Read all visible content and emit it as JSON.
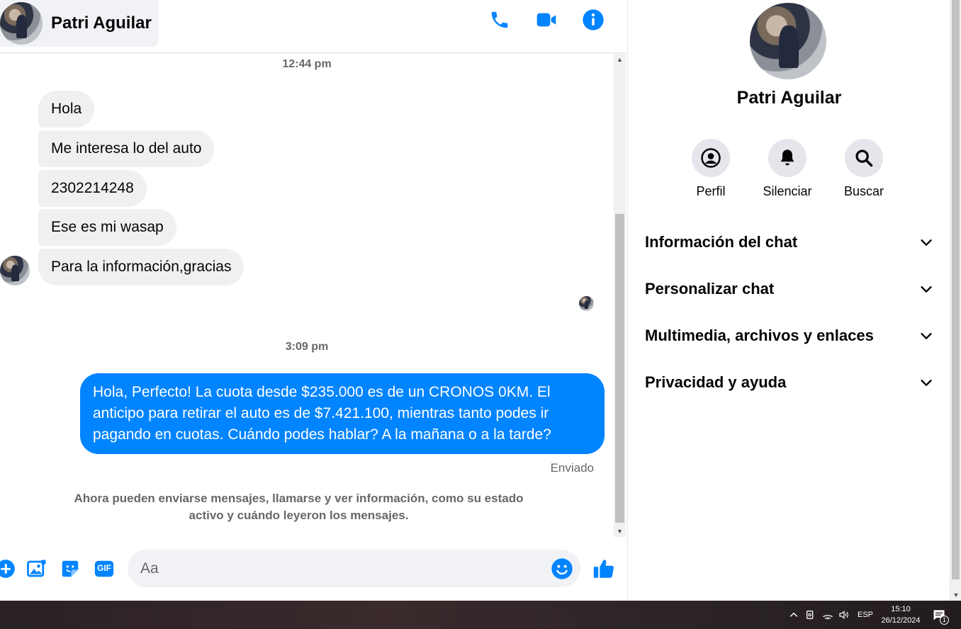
{
  "header": {
    "contact_name": "Patri Aguilar",
    "icons": [
      "phone-icon",
      "video-call-icon",
      "info-icon"
    ]
  },
  "conversation": {
    "divider_1": "12:44 pm",
    "incoming": [
      "Hola",
      "Me interesa lo del auto",
      "2302214248",
      "Ese es mi wasap",
      "Para la información,gracias"
    ],
    "divider_2": "3:09 pm",
    "outgoing": "Hola, Perfecto! La cuota desde $235.000 es de un CRONOS 0KM. El anticipo para retirar el auto es de $7.421.100, mientras tanto podes ir pagando en cuotas. Cuándo podes hablar? A la mañana o a la tarde?",
    "status": "Enviado",
    "notice": "Ahora pueden enviarse mensajes, llamarse y ver información, como su estado activo y cuándo leyeron los mensajes."
  },
  "composer": {
    "placeholder": "Aa",
    "icons": [
      "plus-icon",
      "image-icon",
      "sticker-icon",
      "gif-icon",
      "emoji-icon",
      "like-icon"
    ],
    "gif_label": "GIF"
  },
  "side_panel": {
    "name": "Patri Aguilar",
    "actions": [
      {
        "label": "Perfil",
        "icon": "profile-icon"
      },
      {
        "label": "Silenciar",
        "icon": "bell-icon"
      },
      {
        "label": "Buscar",
        "icon": "search-icon"
      }
    ],
    "sections": [
      "Información del chat",
      "Personalizar chat",
      "Multimedia, archivos y enlaces",
      "Privacidad y ayuda"
    ]
  },
  "taskbar": {
    "language": "ESP",
    "time": "15:10",
    "date": "26/12/2024",
    "notification_count": "1"
  },
  "colors": {
    "accent": "#0084ff",
    "bubble_in": "#f0f0f0",
    "muted_text": "#65676b"
  }
}
